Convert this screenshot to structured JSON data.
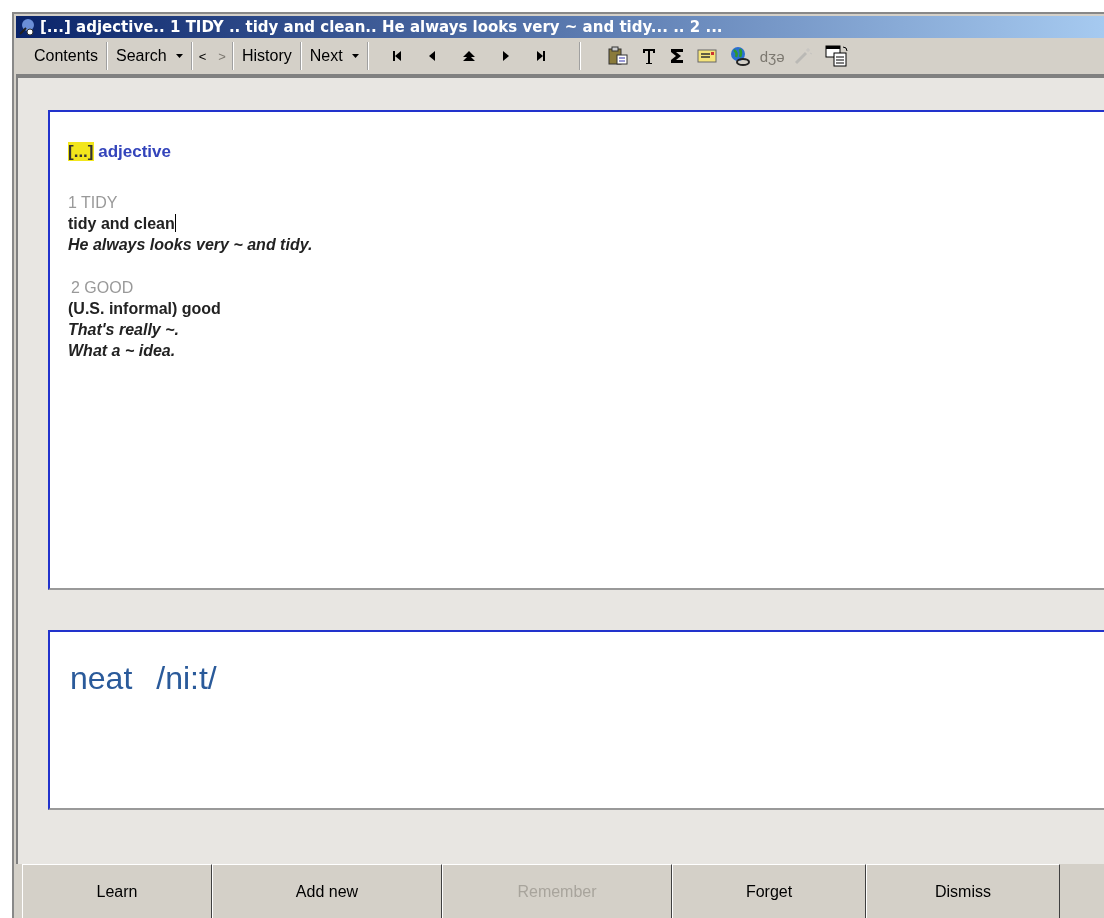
{
  "window": {
    "title": "[...] adjective..  1 TIDY .. tidy and clean.. He always looks very ~ and tidy... .. 2 ..."
  },
  "toolbar": {
    "buttons": [
      {
        "kind": "text",
        "label": "Contents"
      },
      {
        "kind": "dropdown",
        "label": "Search"
      },
      {
        "kind": "pair",
        "label": "<",
        "disabled": false
      },
      {
        "kind": "pair",
        "label": ">",
        "disabled": true
      },
      {
        "kind": "text",
        "label": "History"
      },
      {
        "kind": "dropdown",
        "label": "Next"
      },
      {
        "kind": "icon"
      },
      {
        "kind": "icon"
      },
      {
        "kind": "icon"
      },
      {
        "kind": "icon"
      },
      {
        "kind": "icon"
      },
      {
        "kind": "icon"
      },
      {
        "kind": "icon"
      },
      {
        "kind": "icon"
      },
      {
        "kind": "icon"
      },
      {
        "kind": "icon"
      },
      {
        "kind": "glyph",
        "label": "dʒə",
        "disabled": true
      },
      {
        "kind": "icon",
        "disabled": true
      },
      {
        "kind": "icon"
      }
    ]
  },
  "entry": {
    "marker": "[...]",
    "part_of_speech": "adjective",
    "senses": [
      {
        "heading": "1 TIDY",
        "definition": "tidy and clean",
        "cursor": true,
        "examples": [
          "He always looks very ~ and tidy."
        ]
      },
      {
        "heading": "2 GOOD",
        "definition": "(U.S. informal) good",
        "cursor": false,
        "examples": [
          "That's really ~.",
          "What a ~ idea."
        ]
      }
    ]
  },
  "answer": {
    "word": "neat",
    "pronunciation": "/ni:t/"
  },
  "buttons": [
    {
      "label": "Learn",
      "disabled": false
    },
    {
      "label": "Add new",
      "disabled": false
    },
    {
      "label": "Remember",
      "disabled": true
    },
    {
      "label": "Forget",
      "disabled": false
    },
    {
      "label": "Dismiss",
      "disabled": false
    }
  ]
}
